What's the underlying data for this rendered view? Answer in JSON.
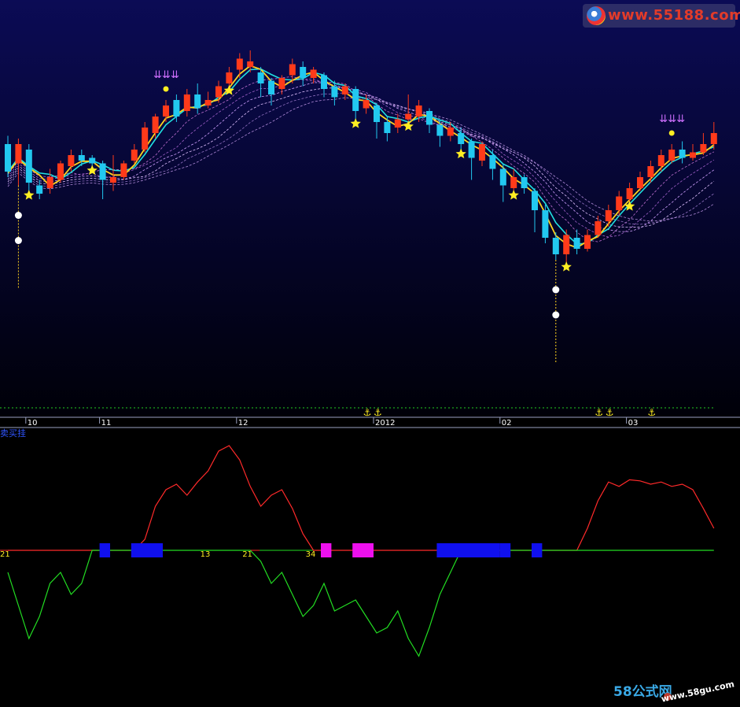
{
  "watermark_top": "www.55188.com",
  "watermark_bottom_brand": "58公式网",
  "watermark_bottom_url": "www.58gu.com",
  "indicator_name": "卖买挂",
  "chart_data": [
    {
      "type": "candlestick",
      "panel": "main",
      "time_axis_labels": [
        "10",
        "11",
        "12",
        "2012",
        "02",
        "03"
      ],
      "time_axis_bar_index": [
        2,
        9,
        22,
        35,
        47,
        59
      ],
      "bars_count": 68,
      "ylim": [
        0,
        100
      ],
      "candles": [
        {
          "o": 62,
          "c": 52,
          "h": 65,
          "l": 50
        },
        {
          "o": 55,
          "c": 62,
          "h": 64,
          "l": 47
        },
        {
          "o": 60,
          "c": 48,
          "h": 62,
          "l": 44
        },
        {
          "o": 47,
          "c": 44,
          "h": 49,
          "l": 42
        },
        {
          "o": 46,
          "c": 50,
          "h": 53,
          "l": 44
        },
        {
          "o": 49,
          "c": 55,
          "h": 56,
          "l": 48
        },
        {
          "o": 54,
          "c": 58,
          "h": 60,
          "l": 52
        },
        {
          "o": 58,
          "c": 56,
          "h": 60,
          "l": 54
        },
        {
          "o": 57,
          "c": 55,
          "h": 58,
          "l": 53
        },
        {
          "o": 55,
          "c": 49,
          "h": 56,
          "l": 42
        },
        {
          "o": 48,
          "c": 50,
          "h": 58,
          "l": 45
        },
        {
          "o": 50,
          "c": 55,
          "h": 56,
          "l": 49
        },
        {
          "o": 56,
          "c": 60,
          "h": 62,
          "l": 55
        },
        {
          "o": 60,
          "c": 68,
          "h": 70,
          "l": 59
        },
        {
          "o": 66,
          "c": 72,
          "h": 73,
          "l": 64
        },
        {
          "o": 72,
          "c": 76,
          "h": 78,
          "l": 70
        },
        {
          "o": 78,
          "c": 72,
          "h": 80,
          "l": 70
        },
        {
          "o": 74,
          "c": 80,
          "h": 82,
          "l": 72
        },
        {
          "o": 80,
          "c": 75,
          "h": 84,
          "l": 73
        },
        {
          "o": 76,
          "c": 78,
          "h": 81,
          "l": 75
        },
        {
          "o": 79,
          "c": 83,
          "h": 85,
          "l": 77
        },
        {
          "o": 84,
          "c": 88,
          "h": 90,
          "l": 82
        },
        {
          "o": 89,
          "c": 93,
          "h": 95,
          "l": 86
        },
        {
          "o": 90,
          "c": 92,
          "h": 96,
          "l": 88
        },
        {
          "o": 88,
          "c": 84,
          "h": 90,
          "l": 79
        },
        {
          "o": 85,
          "c": 80,
          "h": 86,
          "l": 76
        },
        {
          "o": 82,
          "c": 86,
          "h": 87,
          "l": 80
        },
        {
          "o": 87,
          "c": 91,
          "h": 93,
          "l": 84
        },
        {
          "o": 90,
          "c": 86,
          "h": 92,
          "l": 83
        },
        {
          "o": 86,
          "c": 89,
          "h": 90,
          "l": 84
        },
        {
          "o": 87,
          "c": 82,
          "h": 88,
          "l": 79
        },
        {
          "o": 83,
          "c": 79,
          "h": 85,
          "l": 76
        },
        {
          "o": 80,
          "c": 83,
          "h": 84,
          "l": 78
        },
        {
          "o": 82,
          "c": 74,
          "h": 83,
          "l": 70
        },
        {
          "o": 75,
          "c": 78,
          "h": 80,
          "l": 73
        },
        {
          "o": 76,
          "c": 70,
          "h": 77,
          "l": 64
        },
        {
          "o": 70,
          "c": 66,
          "h": 72,
          "l": 63
        },
        {
          "o": 68,
          "c": 71,
          "h": 73,
          "l": 66
        },
        {
          "o": 71,
          "c": 73,
          "h": 80,
          "l": 69
        },
        {
          "o": 72,
          "c": 76,
          "h": 78,
          "l": 70
        },
        {
          "o": 74,
          "c": 69,
          "h": 75,
          "l": 66
        },
        {
          "o": 69,
          "c": 65,
          "h": 71,
          "l": 61
        },
        {
          "o": 65,
          "c": 68,
          "h": 70,
          "l": 63
        },
        {
          "o": 66,
          "c": 62,
          "h": 68,
          "l": 59
        },
        {
          "o": 63,
          "c": 57,
          "h": 64,
          "l": 49
        },
        {
          "o": 56,
          "c": 62,
          "h": 63,
          "l": 54
        },
        {
          "o": 58,
          "c": 53,
          "h": 60,
          "l": 49
        },
        {
          "o": 53,
          "c": 47,
          "h": 55,
          "l": 41
        },
        {
          "o": 46,
          "c": 50,
          "h": 53,
          "l": 44
        },
        {
          "o": 50,
          "c": 46,
          "h": 51,
          "l": 44
        },
        {
          "o": 45,
          "c": 38,
          "h": 46,
          "l": 30
        },
        {
          "o": 38,
          "c": 28,
          "h": 40,
          "l": 26
        },
        {
          "o": 28,
          "c": 22,
          "h": 30,
          "l": 20
        },
        {
          "o": 22,
          "c": 29,
          "h": 31,
          "l": 18
        },
        {
          "o": 28,
          "c": 24,
          "h": 31,
          "l": 22
        },
        {
          "o": 24,
          "c": 29,
          "h": 31,
          "l": 23
        },
        {
          "o": 29,
          "c": 34,
          "h": 36,
          "l": 28
        },
        {
          "o": 34,
          "c": 38,
          "h": 40,
          "l": 32
        },
        {
          "o": 38,
          "c": 43,
          "h": 45,
          "l": 36
        },
        {
          "o": 42,
          "c": 46,
          "h": 48,
          "l": 40
        },
        {
          "o": 46,
          "c": 50,
          "h": 52,
          "l": 45
        },
        {
          "o": 50,
          "c": 54,
          "h": 56,
          "l": 48
        },
        {
          "o": 54,
          "c": 58,
          "h": 60,
          "l": 52
        },
        {
          "o": 56,
          "c": 60,
          "h": 62,
          "l": 55
        },
        {
          "o": 60,
          "c": 57,
          "h": 63,
          "l": 55
        },
        {
          "o": 57,
          "c": 59,
          "h": 62,
          "l": 56
        },
        {
          "o": 59,
          "c": 62,
          "h": 66,
          "l": 58
        },
        {
          "o": 62,
          "c": 66,
          "h": 70,
          "l": 60
        }
      ],
      "buy_star_bars": [
        2,
        8,
        21,
        33,
        38,
        43,
        48,
        53,
        59
      ],
      "top_marker_bars": [
        15,
        63
      ],
      "bottom_marker_bars": [
        1,
        52
      ]
    },
    {
      "type": "line",
      "panel": "indicator",
      "title": "卖买挂",
      "baseline_labels": [
        {
          "text": "21",
          "bar": 0
        },
        {
          "text": "13",
          "bar": 19
        },
        {
          "text": "21",
          "bar": 23
        },
        {
          "text": "34",
          "bar": 29
        }
      ],
      "ylim": [
        -100,
        100
      ],
      "series": [
        {
          "color": "#ff2a2a",
          "values": [
            0,
            0,
            0,
            0,
            0,
            0,
            0,
            0,
            0,
            0,
            0,
            0,
            0,
            10,
            40,
            55,
            60,
            50,
            62,
            72,
            90,
            95,
            82,
            58,
            40,
            50,
            55,
            38,
            15,
            0,
            0,
            0,
            0,
            0,
            0,
            0,
            0,
            0,
            0,
            0,
            0,
            0,
            0,
            0,
            0,
            0,
            0,
            0,
            0,
            0,
            0,
            0,
            0,
            0,
            0,
            20,
            45,
            62,
            58,
            64,
            63,
            60,
            62,
            58,
            60,
            55,
            38,
            20
          ]
        },
        {
          "color": "#22dd22",
          "values": [
            -20,
            -50,
            -80,
            -60,
            -30,
            -20,
            -40,
            -30,
            0,
            0,
            0,
            0,
            0,
            0,
            0,
            0,
            0,
            0,
            0,
            0,
            0,
            0,
            0,
            0,
            -10,
            -30,
            -20,
            -40,
            -60,
            -50,
            -30,
            -55,
            -50,
            -45,
            -60,
            -75,
            -70,
            -55,
            -80,
            -96,
            -70,
            -40,
            -20,
            0,
            0,
            0,
            0,
            0,
            0,
            0,
            0,
            0,
            0,
            0,
            0,
            0,
            0,
            0,
            0,
            0,
            0,
            0,
            0,
            0,
            0,
            0,
            0,
            0
          ]
        }
      ],
      "blocks": [
        {
          "color": "#1010ee",
          "start_bar": 9,
          "end_bar": 10
        },
        {
          "color": "#1010ee",
          "start_bar": 12,
          "end_bar": 15
        },
        {
          "color": "#ee10ee",
          "start_bar": 30,
          "end_bar": 31
        },
        {
          "color": "#ee10ee",
          "start_bar": 33,
          "end_bar": 35
        },
        {
          "color": "#1010ee",
          "start_bar": 41,
          "end_bar": 47
        },
        {
          "color": "#1010ee",
          "start_bar": 47,
          "end_bar": 48
        },
        {
          "color": "#1010ee",
          "start_bar": 50,
          "end_bar": 51
        }
      ]
    }
  ],
  "colors": {
    "bg_top": "#0b0b55",
    "bg_bottom": "#000008",
    "up": "#ff3a1a",
    "down": "#22c8f0",
    "star": "#ffee22",
    "ma_fast": "#ffd21e",
    "ma_mid": "#20e0e0"
  }
}
